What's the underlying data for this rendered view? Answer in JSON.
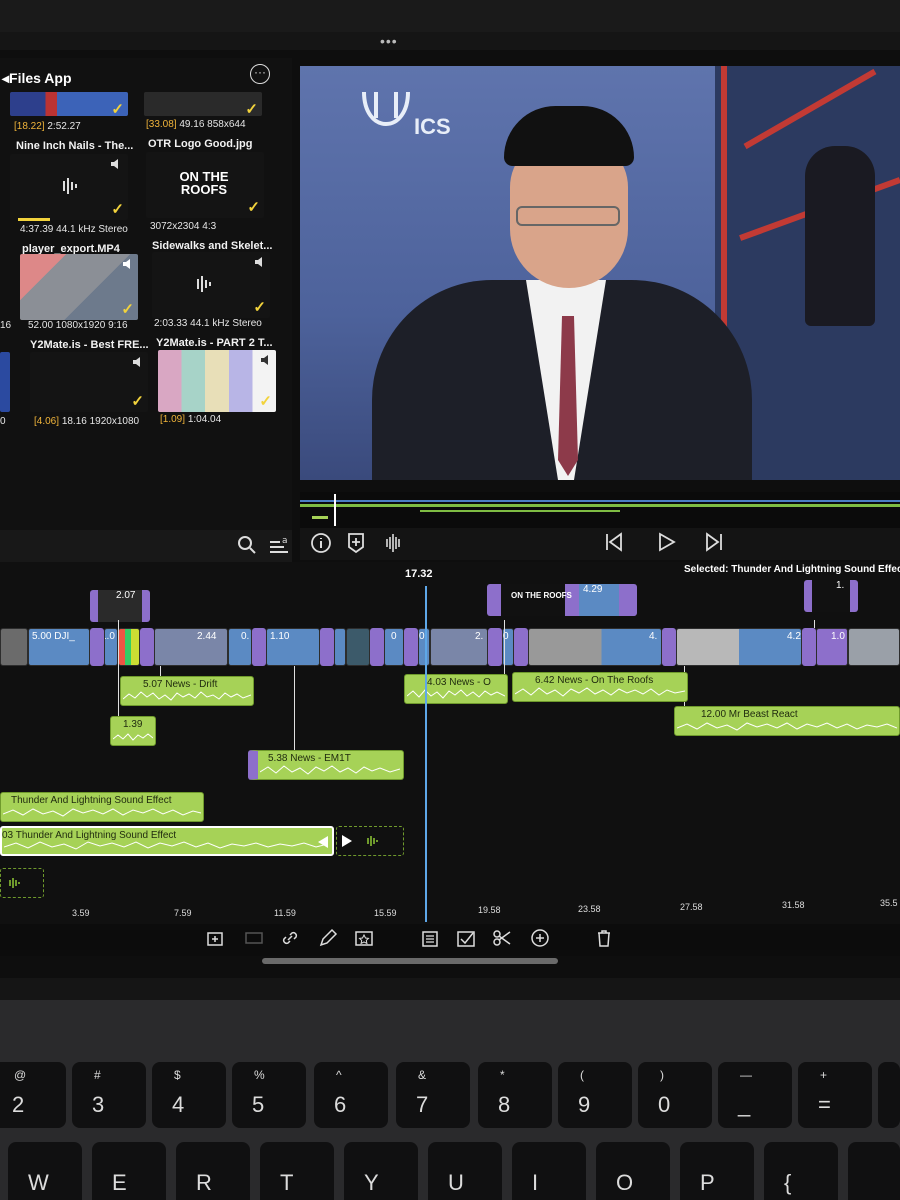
{
  "window": {
    "more_label": "•••"
  },
  "browser": {
    "header": "◂Files App",
    "menu_label": "···",
    "items": [
      {
        "meta_prefix": "[18.22]",
        "meta": "2:52.27",
        "name": "Nine Inch Nails - The..."
      },
      {
        "meta_prefix": "[33.08]",
        "meta": "49.16  858x644",
        "name": "OTR Logo Good.jpg"
      },
      {
        "meta_prefix": "",
        "meta": "4:37.39  44.1 kHz  Stereo",
        "name": "player_export.MP4"
      },
      {
        "meta_prefix": "",
        "meta": "3072x2304  4:3",
        "name": "Sidewalks and Skelet..."
      },
      {
        "meta_prefix": "",
        "meta": "52.00  1080x1920  9:16",
        "name": "Y2Mate.is - Best FRE..."
      },
      {
        "meta_prefix": "",
        "meta": "2:03.33  44.1 kHz  Stereo",
        "name": "Y2Mate.is - PART 2 T..."
      },
      {
        "meta_prefix": "[4.06]",
        "meta": "18.16  1920x1080",
        "name": ""
      },
      {
        "meta_prefix": "[1.09]",
        "meta": "1:04.04",
        "name": ""
      }
    ],
    "left_edge_labels": [
      "16",
      "0"
    ],
    "logo_text": "ON THE ROOFS"
  },
  "viewer": {
    "logo_text": "ICS"
  },
  "timeline": {
    "playhead_time": "17.32",
    "selected": "Selected: Thunder And Lightning Sound Effect S",
    "video_clips": [
      {
        "label": "5.00  DJI_"
      },
      {
        "label": "1.0"
      },
      {
        "label": "2.44"
      },
      {
        "label": "0."
      },
      {
        "label": "1.10"
      },
      {
        "label": "0"
      },
      {
        "label": "0"
      },
      {
        "label": "2."
      },
      {
        "label": "0"
      },
      {
        "label": "4."
      },
      {
        "label": "4.2"
      },
      {
        "label": "1.0"
      }
    ],
    "title_clips": [
      {
        "label": "2.07"
      },
      {
        "label": "4.29"
      },
      {
        "label": "1."
      }
    ],
    "audio_clips": [
      {
        "label": "5.07  News - Drift"
      },
      {
        "label": "4.03  News - O"
      },
      {
        "label": "6.42  News - On The Roofs"
      },
      {
        "label": "12.00  Mr Beast React"
      },
      {
        "label": "1.39"
      },
      {
        "label": "5.38  News - EM1T"
      },
      {
        "label": "Thunder And Lightning Sound Effect"
      },
      {
        "label": "03  Thunder And Lightning Sound Effect"
      }
    ],
    "ruler": [
      "3.59",
      "7.59",
      "11.59",
      "15.59",
      "19.58",
      "23.58",
      "27.58",
      "31.58",
      "35.5"
    ]
  },
  "keyboard": {
    "row1": [
      {
        "top": "@",
        "bot": "2"
      },
      {
        "top": "#",
        "bot": "3"
      },
      {
        "top": "$",
        "bot": "4"
      },
      {
        "top": "%",
        "bot": "5"
      },
      {
        "top": "^",
        "bot": "6"
      },
      {
        "top": "&",
        "bot": "7"
      },
      {
        "top": "*",
        "bot": "8"
      },
      {
        "top": "(",
        "bot": "9"
      },
      {
        "top": ")",
        "bot": "0"
      },
      {
        "top": "—",
        "bot": "_"
      },
      {
        "top": "+",
        "bot": "="
      }
    ],
    "row2": [
      "W",
      "E",
      "R",
      "T",
      "Y",
      "U",
      "I",
      "O",
      "P",
      "{"
    ]
  },
  "colors": {
    "audio_clip": "#a6d257",
    "video_clip": "#5b8ac3",
    "transition": "#8d6fcb",
    "playhead": "#5ea7e8",
    "accent_yellow": "#f2d33c"
  }
}
